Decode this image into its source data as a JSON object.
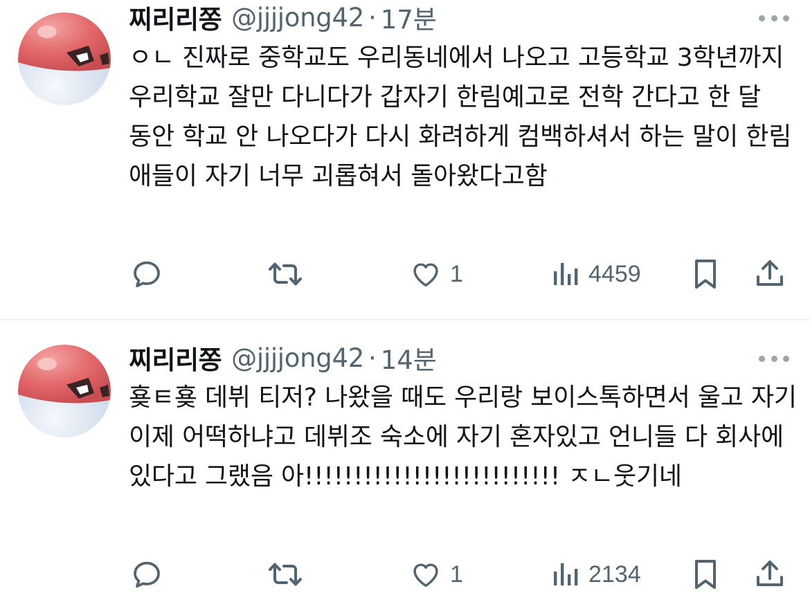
{
  "tweets": [
    {
      "display_name": "찌리리쫑",
      "handle": "@jjjjong42",
      "separator": "·",
      "time": "17분",
      "text": "ㅇㄴ 진짜로 중학교도 우리동네에서 나오고 고등학교 3학년까지 우리학교 잘만 다니다가 갑자기 한림예고로 전학 간다고 한 달 동안 학교 안 나오다가 다시 화려하게 컴백하셔서 하는 말이 한림 애들이 자기 너무 괴롭혀서 돌아왔다고함",
      "likes": "1",
      "views": "4459"
    },
    {
      "display_name": "찌리리쫑",
      "handle": "@jjjjong42",
      "separator": "·",
      "time": "14분",
      "text": "횾ㅌ횾 데뷔 티저? 나왔을 때도 우리랑 보이스톡하면서 울고 자기 이제 어떡하냐고 데뷔조 숙소에 자기 혼자있고 언니들 다 회사에 있다고 그랬음 아!!!!!!!!!!!!!!!!!!!!!!!!!! ㅈㄴ웃기네",
      "likes": "1",
      "views": "2134"
    }
  ],
  "icons": {
    "avatar": "voltorb-avatar",
    "more": "more-icon",
    "reply": "reply-icon",
    "retweet": "retweet-icon",
    "like": "heart-icon",
    "views": "views-icon",
    "bookmark": "bookmark-icon",
    "share": "share-icon"
  },
  "colors": {
    "text": "#0f1419",
    "secondary": "#536471",
    "divider": "#eff3f4",
    "avatar_red": "#e2686a",
    "avatar_white": "#e8eef8"
  }
}
